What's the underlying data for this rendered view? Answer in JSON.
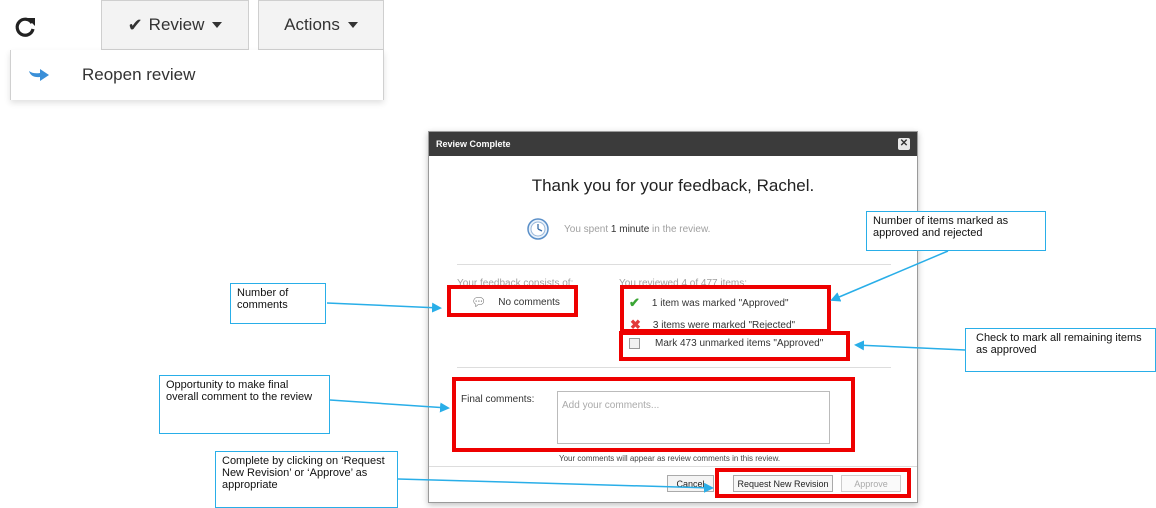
{
  "toolbar": {
    "refresh_icon": "refresh-icon",
    "review_label": "Review",
    "actions_label": "Actions",
    "menu_item_label": "Reopen review",
    "menu_item_icon": "redo-arrow-icon"
  },
  "dialog": {
    "title": "Review Complete",
    "thank_you": "Thank you for your feedback, Rachel.",
    "time_prefix": "You spent ",
    "time_value": "1 minute",
    "time_suffix": " in the review.",
    "feedback_heading": "Your feedback consists of:",
    "comments_label": "No comments",
    "reviewed_heading": "You reviewed 4 of 477 items:",
    "approved_label": "1 item was marked \"Approved\"",
    "rejected_label": "3 items were marked \"Rejected\"",
    "mark_unmarked_label": "Mark 473 unmarked items \"Approved\"",
    "final_comments_label": "Final comments:",
    "final_comments_placeholder": "Add your comments...",
    "comments_note": "Your comments will appear as review comments in this review.",
    "cancel_label": "Cancel",
    "request_revision_label": "Request New Revision",
    "approve_label": "Approve"
  },
  "callouts": {
    "comments": "Number of comments",
    "approved_rejected": "Number of items marked as approved and rejected",
    "check_all": "Check to mark all remaining items as approved",
    "final_comment": "Opportunity to make final overall comment to the review",
    "complete": "Complete by clicking on ‘Request New Revision’ or ‘Approve’ as appropriate"
  },
  "colors": {
    "highlight_red": "#ee0000",
    "callout_blue": "#29aee8",
    "approve_green": "#3aa534",
    "reject_red": "#e23b3b",
    "title_bar": "#3b3b3b"
  }
}
